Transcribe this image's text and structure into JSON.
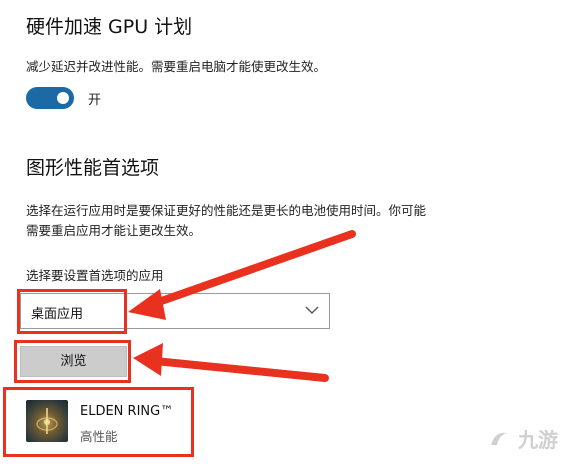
{
  "gpu_section": {
    "title": "硬件加速 GPU 计划",
    "description": "减少延迟并改进性能。需要重启电脑才能使更改生效。",
    "toggle_state_label": "开",
    "toggle_on": true
  },
  "graphics_section": {
    "title": "图形性能首选项",
    "description_line1": "选择在运行应用时是要保证更好的性能还是更长的电池使用时间。你可能",
    "description_line2": "需要重启应用才能让更改生效。",
    "select_label": "选择要设置首选项的应用",
    "dropdown_value": "桌面应用",
    "browse_label": "浏览"
  },
  "app_list": [
    {
      "name": "ELDEN RING™",
      "preference": "高性能",
      "icon": "elden-ring-app-icon"
    }
  ],
  "colors": {
    "toggle_accent": "#1b6aa6",
    "highlight_red": "#e8321f"
  },
  "watermark": {
    "logo_text": "九游"
  }
}
